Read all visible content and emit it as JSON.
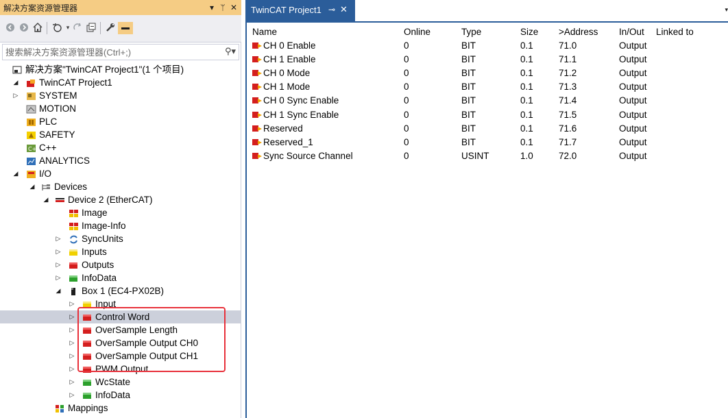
{
  "solution_explorer": {
    "title": "解决方案资源管理器",
    "title_controls": {
      "dropdown": "▾",
      "pin": "ᛘ",
      "close": "✕"
    },
    "search": {
      "placeholder": "搜索解决方案资源管理器(Ctrl+;)",
      "value": ""
    },
    "tree": [
      {
        "label": "解决方案\"TwinCAT Project1\"(1 个项目)",
        "depth": 0,
        "expander": "",
        "icon": "solution-icon"
      },
      {
        "label": "TwinCAT Project1",
        "depth": 0,
        "expander": "◢",
        "icon": "twincat-project-icon"
      },
      {
        "label": "SYSTEM",
        "depth": 1,
        "expander": "▷",
        "icon": "system-icon"
      },
      {
        "label": "MOTION",
        "depth": 1,
        "expander": "",
        "icon": "motion-icon"
      },
      {
        "label": "PLC",
        "depth": 1,
        "expander": "",
        "icon": "plc-icon"
      },
      {
        "label": "SAFETY",
        "depth": 1,
        "expander": "",
        "icon": "safety-icon"
      },
      {
        "label": "C++",
        "depth": 1,
        "expander": "",
        "icon": "cpp-icon"
      },
      {
        "label": "ANALYTICS",
        "depth": 1,
        "expander": "",
        "icon": "analytics-icon"
      },
      {
        "label": "I/O",
        "depth": 1,
        "expander": "◢",
        "icon": "io-icon"
      },
      {
        "label": "Devices",
        "depth": 2,
        "expander": "◢",
        "icon": "devices-icon"
      },
      {
        "label": "Device 2 (EtherCAT)",
        "depth": 3,
        "expander": "◢",
        "icon": "ethercat-device-icon"
      },
      {
        "label": "Image",
        "depth": 4,
        "expander": "",
        "icon": "image-icon"
      },
      {
        "label": "Image-Info",
        "depth": 4,
        "expander": "",
        "icon": "image-icon"
      },
      {
        "label": "SyncUnits",
        "depth": 4,
        "expander": "▷",
        "icon": "syncunits-icon"
      },
      {
        "label": "Inputs",
        "depth": 4,
        "expander": "▷",
        "icon": "inputs-icon"
      },
      {
        "label": "Outputs",
        "depth": 4,
        "expander": "▷",
        "icon": "outputs-icon"
      },
      {
        "label": "InfoData",
        "depth": 4,
        "expander": "▷",
        "icon": "infodata-icon"
      },
      {
        "label": "Box 1 (EC4-PX02B)",
        "depth": 4,
        "expander": "◢",
        "icon": "box-icon"
      },
      {
        "label": "Input",
        "depth": 5,
        "expander": "▷",
        "icon": "input-icon"
      },
      {
        "label": "Control Word",
        "depth": 5,
        "expander": "▷",
        "icon": "output-icon",
        "selected": true
      },
      {
        "label": "OverSample Length",
        "depth": 5,
        "expander": "▷",
        "icon": "output-icon"
      },
      {
        "label": "OverSample Output CH0",
        "depth": 5,
        "expander": "▷",
        "icon": "output-icon"
      },
      {
        "label": "OverSample Output CH1",
        "depth": 5,
        "expander": "▷",
        "icon": "output-icon"
      },
      {
        "label": "PWM Output",
        "depth": 5,
        "expander": "▷",
        "icon": "output-icon"
      },
      {
        "label": "WcState",
        "depth": 5,
        "expander": "▷",
        "icon": "wcstate-icon"
      },
      {
        "label": "InfoData",
        "depth": 5,
        "expander": "▷",
        "icon": "infodata-icon"
      },
      {
        "label": "Mappings",
        "depth": 3,
        "expander": "",
        "icon": "mappings-icon"
      }
    ]
  },
  "document": {
    "tab": {
      "title": "TwinCAT Project1",
      "pin": "⊸",
      "close": "✕"
    },
    "tabs_dropdown": "▾",
    "columns": [
      "Name",
      "Online",
      "Type",
      "Size",
      ">Address",
      "In/Out",
      "Linked to"
    ],
    "rows": [
      [
        "CH 0 Enable",
        "0",
        "BIT",
        "0.1",
        "71.0",
        "Output",
        ""
      ],
      [
        "CH 1 Enable",
        "0",
        "BIT",
        "0.1",
        "71.1",
        "Output",
        ""
      ],
      [
        "CH 0 Mode",
        "0",
        "BIT",
        "0.1",
        "71.2",
        "Output",
        ""
      ],
      [
        "CH 1 Mode",
        "0",
        "BIT",
        "0.1",
        "71.3",
        "Output",
        ""
      ],
      [
        "CH 0 Sync Enable",
        "0",
        "BIT",
        "0.1",
        "71.4",
        "Output",
        ""
      ],
      [
        "CH 1 Sync Enable",
        "0",
        "BIT",
        "0.1",
        "71.5",
        "Output",
        ""
      ],
      [
        "Reserved",
        "0",
        "BIT",
        "0.1",
        "71.6",
        "Output",
        ""
      ],
      [
        "Reserved_1",
        "0",
        "BIT",
        "0.1",
        "71.7",
        "Output",
        ""
      ],
      [
        "Sync Source Channel",
        "0",
        "USINT",
        "1.0",
        "72.0",
        "Output",
        ""
      ]
    ]
  },
  "colors": {
    "se_title_bar": "#f5cc84",
    "doc_tab_active": "#2b5d9a",
    "selected_row": "#ccd0db",
    "highlight_box": "#e8303a"
  }
}
